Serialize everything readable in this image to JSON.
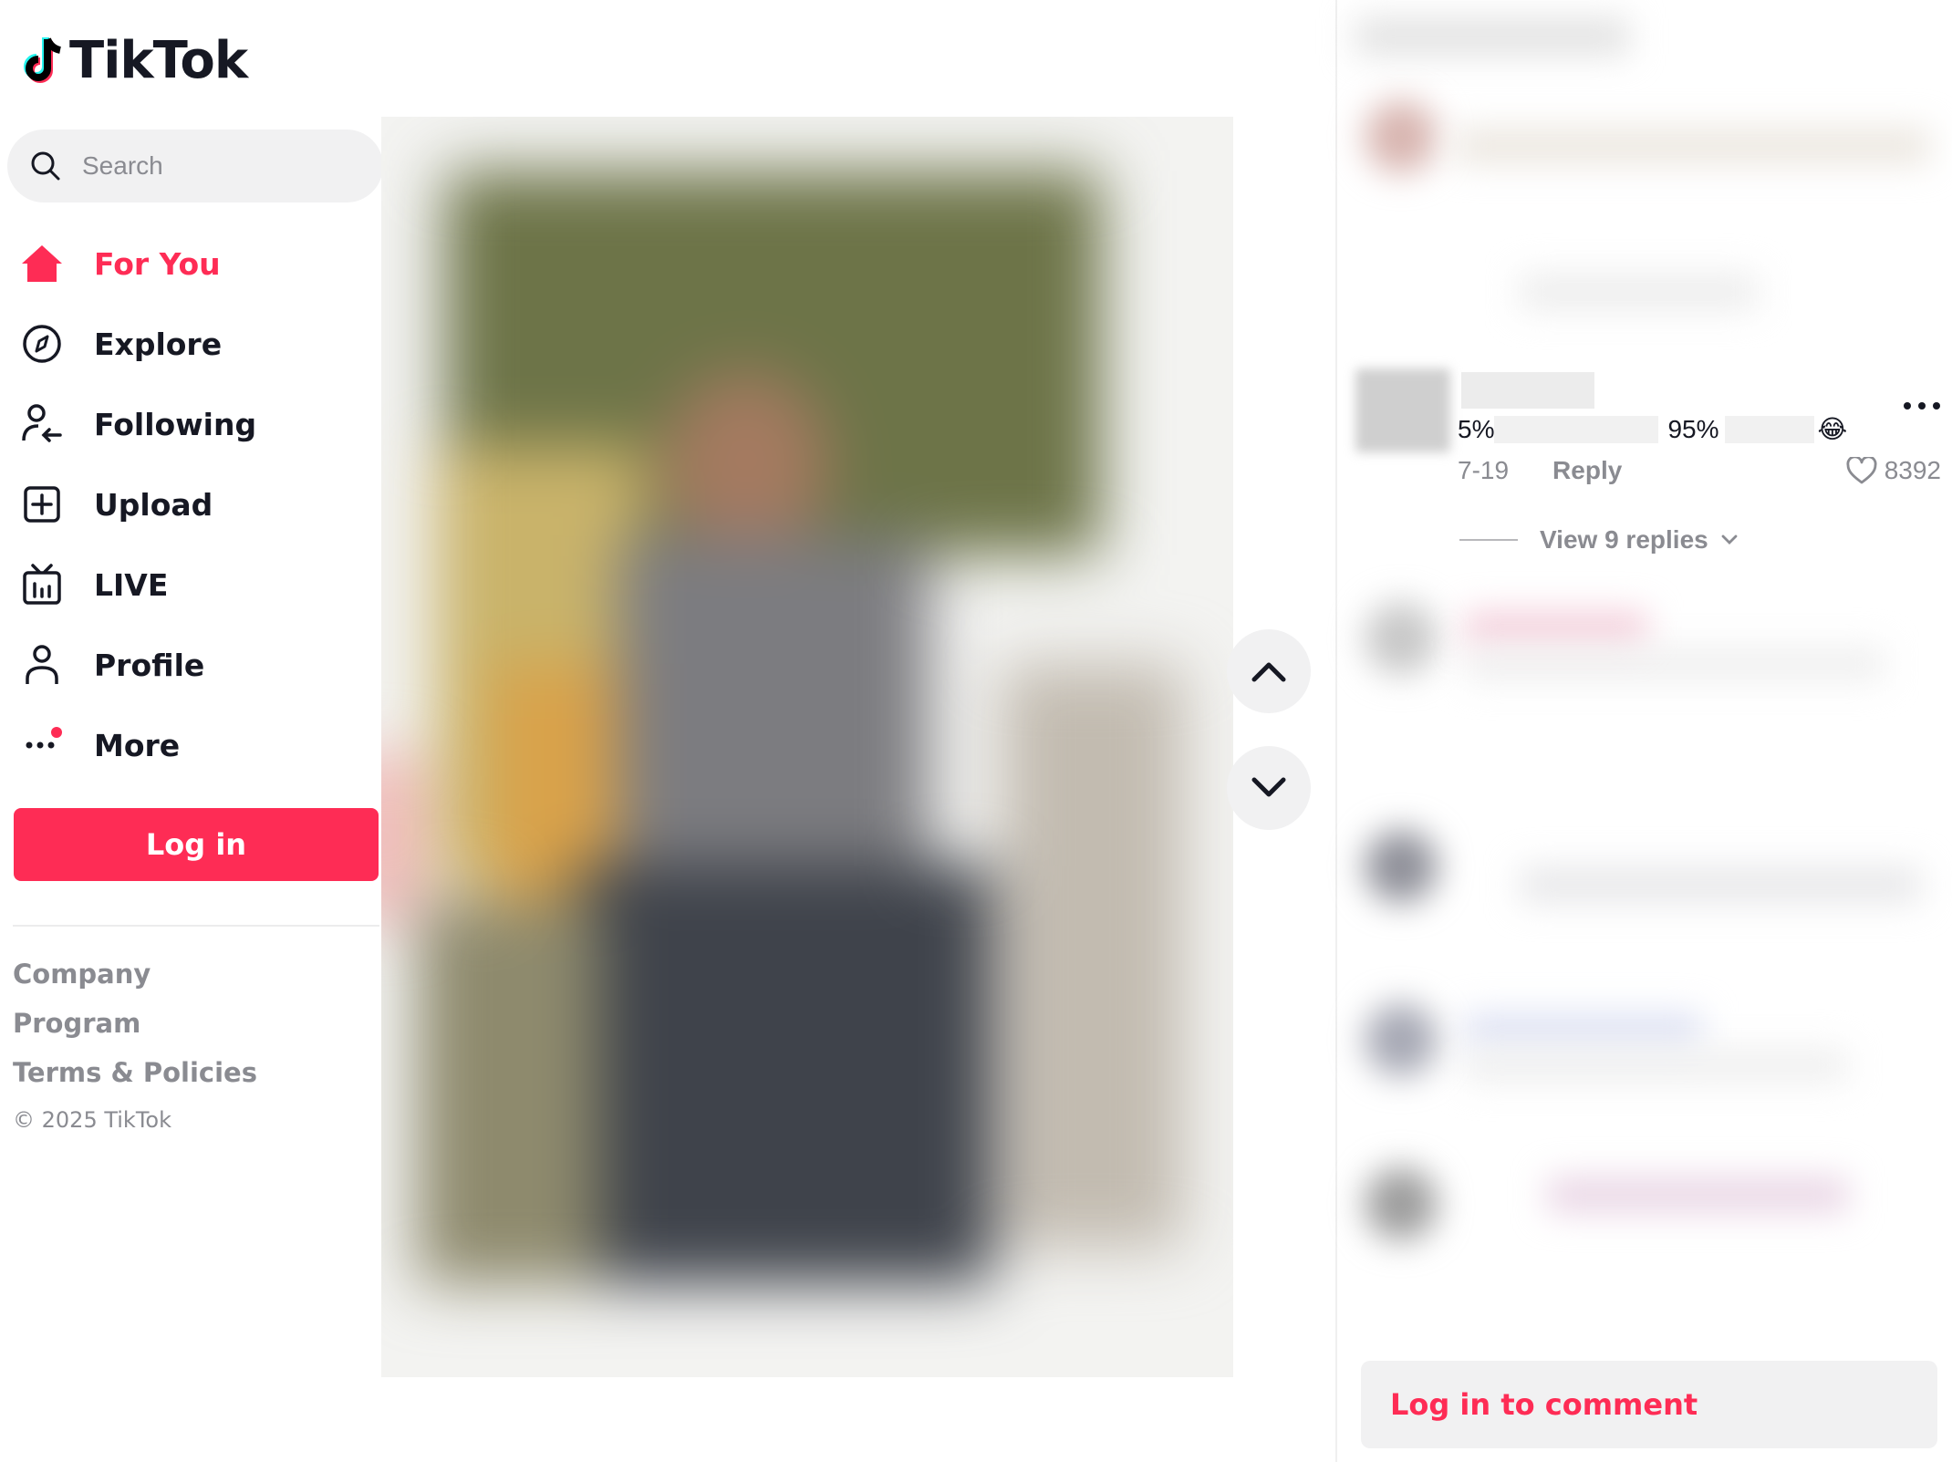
{
  "app": {
    "name": "TikTok"
  },
  "search": {
    "placeholder": "Search"
  },
  "sidebar": {
    "items": [
      {
        "label": "For You",
        "icon": "home-icon",
        "active": true
      },
      {
        "label": "Explore",
        "icon": "compass-icon"
      },
      {
        "label": "Following",
        "icon": "following-icon"
      },
      {
        "label": "Upload",
        "icon": "upload-icon"
      },
      {
        "label": "LIVE",
        "icon": "live-icon"
      },
      {
        "label": "Profile",
        "icon": "profile-icon"
      },
      {
        "label": "More",
        "icon": "more-icon"
      }
    ],
    "login_label": "Log in",
    "footer_links": [
      "Company",
      "Program",
      "Terms & Policies"
    ],
    "copyright": "© 2025 TikTok"
  },
  "comment": {
    "text_part1": "5%",
    "text_part2": "95%",
    "emoji": "😂",
    "date": "7-19",
    "reply_label": "Reply",
    "likes": "8392",
    "view_replies": "View 9 replies"
  },
  "comments_footer": {
    "login_label": "Log in to comment"
  },
  "colors": {
    "accent": "#fe2c55",
    "muted": "#8a8b91",
    "text": "#161823"
  }
}
